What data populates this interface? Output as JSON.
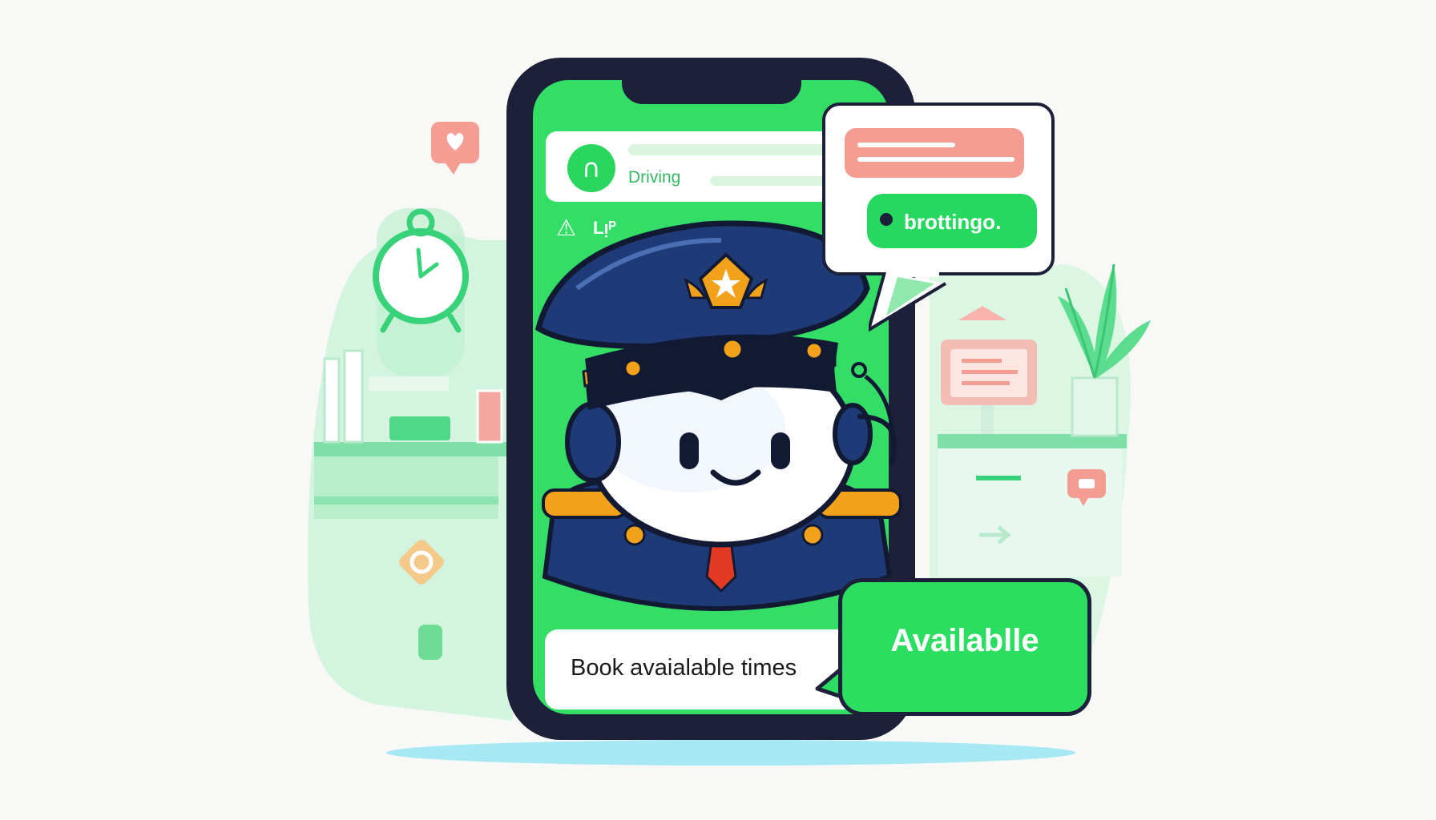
{
  "phone": {
    "status_card": {
      "icon": "headset-icon",
      "label": "Driving"
    },
    "warning": {
      "icon": "warning-icon",
      "label": "Lᴉᴾ"
    },
    "book_bar": {
      "label": "Book  avaialable times"
    }
  },
  "bubble": {
    "status_dot_color": "#1c2039",
    "label": "brottingo."
  },
  "badge": {
    "label": "Availablle"
  },
  "mascot": {
    "description_icon": "officer-mascot-icon"
  },
  "colors": {
    "accent_green": "#2bde5f",
    "navy": "#1c2039",
    "salmon": "#f59c93",
    "mint": "#c9f3d8"
  }
}
